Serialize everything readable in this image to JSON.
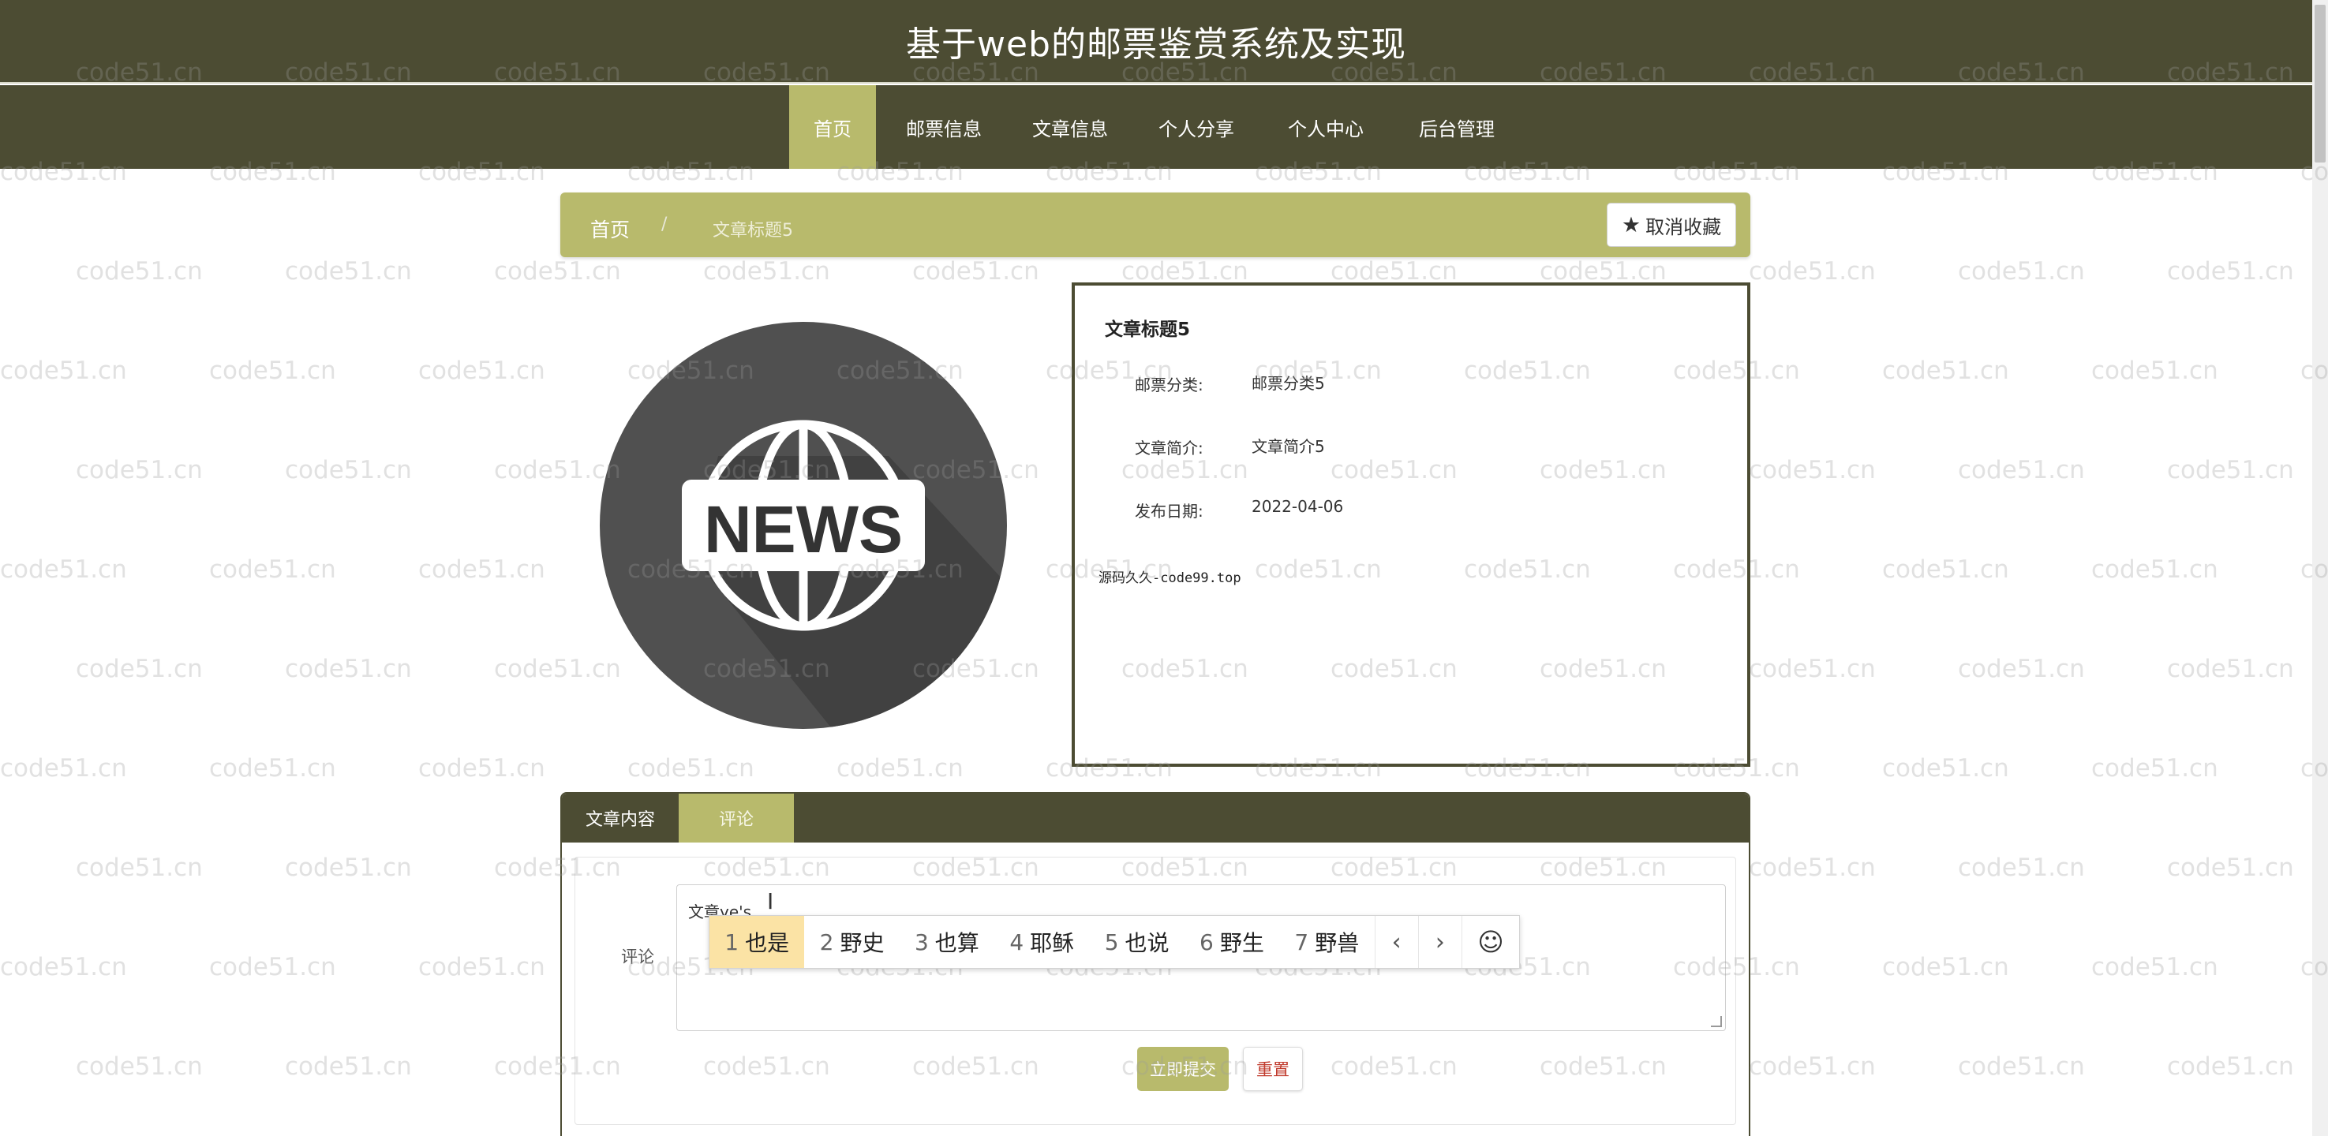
{
  "site": {
    "title": "基于web的邮票鉴赏系统及实现"
  },
  "nav": {
    "items": [
      {
        "label": "首页",
        "active": true
      },
      {
        "label": "邮票信息",
        "active": false
      },
      {
        "label": "文章信息",
        "active": false
      },
      {
        "label": "个人分享",
        "active": false
      },
      {
        "label": "个人中心",
        "active": false
      },
      {
        "label": "后台管理",
        "active": false
      }
    ]
  },
  "breadcrumb": {
    "home": "首页",
    "separator": "/",
    "current": "文章标题5"
  },
  "favorite": {
    "label": "取消收藏",
    "icon": "star-icon"
  },
  "image": {
    "text": "NEWS",
    "icon": "globe-icon"
  },
  "detail": {
    "title": "文章标题5",
    "fields": [
      {
        "label": "邮票分类:",
        "value": "邮票分类5"
      },
      {
        "label": "文章简介:",
        "value": "文章简介5"
      },
      {
        "label": "发布日期:",
        "value": "2022-04-06"
      }
    ],
    "source_text": "源码久久-code99.top"
  },
  "tabs": [
    {
      "label": "文章内容",
      "active": false
    },
    {
      "label": "评论",
      "active": true
    }
  ],
  "comment": {
    "label": "评论",
    "value": "文章ye's",
    "submit_label": "立即提交",
    "reset_label": "重置"
  },
  "ime": {
    "candidates": [
      {
        "num": "1",
        "text": "也是",
        "selected": true
      },
      {
        "num": "2",
        "text": "野史",
        "selected": false
      },
      {
        "num": "3",
        "text": "也算",
        "selected": false
      },
      {
        "num": "4",
        "text": "耶稣",
        "selected": false
      },
      {
        "num": "5",
        "text": "也说",
        "selected": false
      },
      {
        "num": "6",
        "text": "野生",
        "selected": false
      },
      {
        "num": "7",
        "text": "野兽",
        "selected": false
      }
    ],
    "prev_icon": "‹",
    "next_icon": "›",
    "emoji_icon": "☺"
  },
  "watermark": {
    "text": "code51.cn"
  },
  "colors": {
    "primary": "#4c4c33",
    "accent": "#b8ba6c",
    "danger": "#c0392b"
  }
}
